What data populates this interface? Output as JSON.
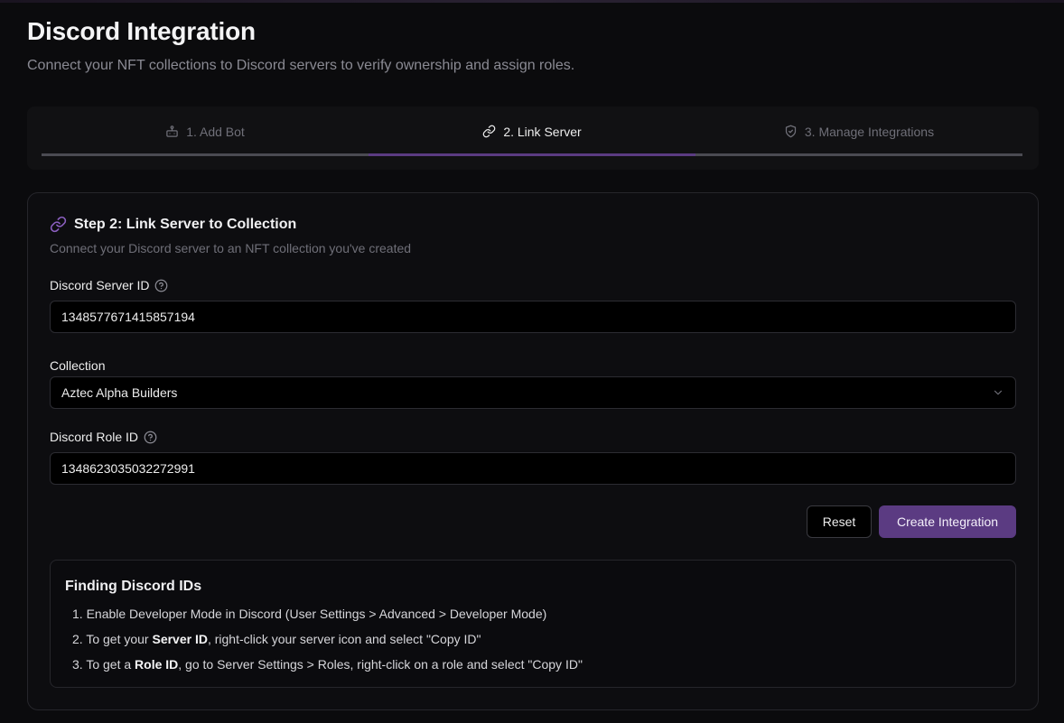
{
  "header": {
    "title": "Discord Integration",
    "subtitle": "Connect your NFT collections to Discord servers to verify ownership and assign roles."
  },
  "tabs": [
    {
      "label": "1. Add Bot",
      "icon": "bot-icon",
      "active": false
    },
    {
      "label": "2. Link Server",
      "icon": "link-icon",
      "active": true
    },
    {
      "label": "3. Manage Integrations",
      "icon": "shield-check-icon",
      "active": false
    }
  ],
  "card": {
    "title": "Step 2: Link Server to Collection",
    "description": "Connect your Discord server to an NFT collection you've created",
    "server_id": {
      "label": "Discord Server ID",
      "value": "1348577671415857194"
    },
    "collection": {
      "label": "Collection",
      "value": "Aztec Alpha Builders"
    },
    "role_id": {
      "label": "Discord Role ID",
      "value": "1348623035032272991"
    },
    "reset_label": "Reset",
    "create_label": "Create Integration"
  },
  "help": {
    "title": "Finding Discord IDs",
    "items": [
      {
        "num": "1.",
        "pre": "Enable Developer Mode in Discord (User Settings > Advanced > Developer Mode)",
        "bold": "",
        "post": ""
      },
      {
        "num": "2.",
        "pre": "To get your ",
        "bold": "Server ID",
        "post": ", right-click your server icon and select \"Copy ID\""
      },
      {
        "num": "3.",
        "pre": "To get a ",
        "bold": "Role ID",
        "post": ", go to Server Settings > Roles, right-click on a role and select \"Copy ID\""
      }
    ]
  },
  "colors": {
    "accent": "#5b3b82",
    "background": "#0b0b0d"
  }
}
